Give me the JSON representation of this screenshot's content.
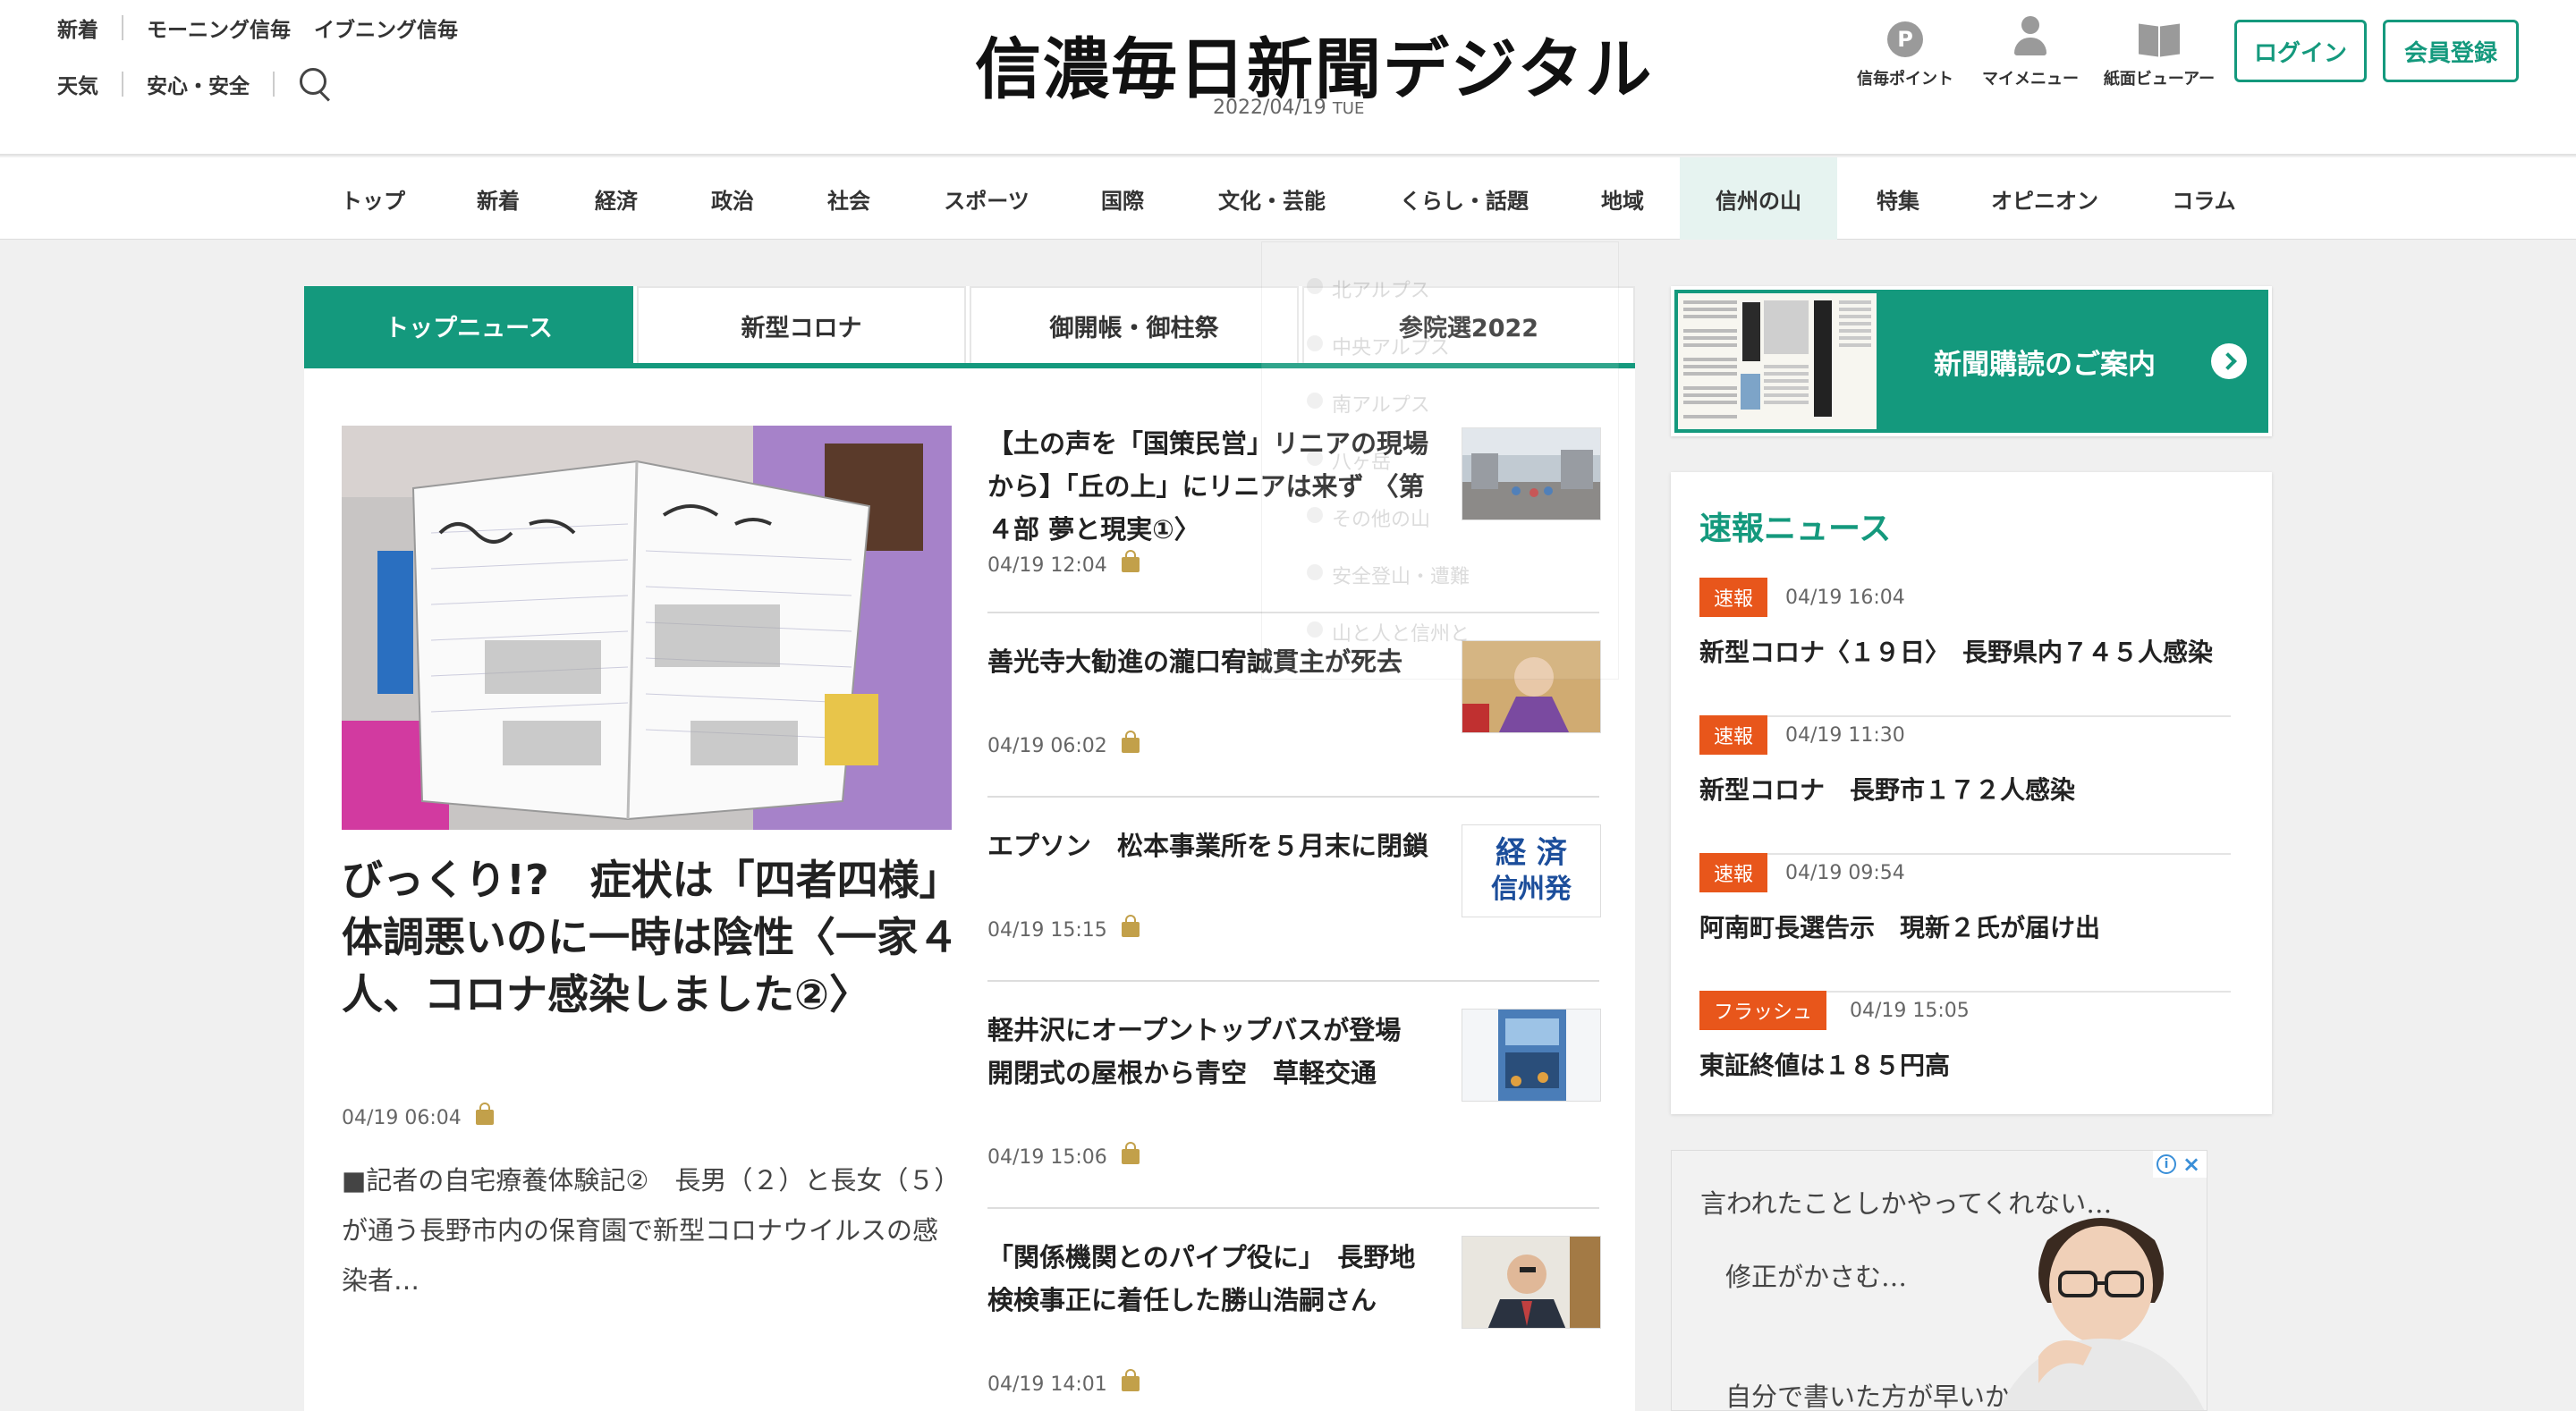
{
  "header": {
    "links_row1": [
      "新着",
      "モーニング信毎",
      "イブニング信毎"
    ],
    "links_row2": [
      "天気",
      "安心・安全"
    ],
    "logo": "信濃毎日新聞デジタル",
    "date": "2022/04/19",
    "weekday": "TUE",
    "icons": [
      {
        "label": "信毎ポイント",
        "icon": "points-icon"
      },
      {
        "label": "マイメニュー",
        "icon": "user-icon"
      },
      {
        "label": "紙面ビューアー",
        "icon": "book-icon"
      }
    ],
    "login_label": "ログイン",
    "register_label": "会員登録",
    "accent": "#14997d"
  },
  "nav": [
    "トップ",
    "新着",
    "経済",
    "政治",
    "社会",
    "スポーツ",
    "国際",
    "文化・芸能",
    "くらし・話題",
    "地域",
    "信州の山",
    "特集",
    "オピニオン",
    "コラム"
  ],
  "dropdown": [
    "北アルプス",
    "中央アルプス",
    "南アルプス",
    "八ヶ岳",
    "その他の山",
    "安全登山・遭難",
    "山と人と信州と"
  ],
  "tabs": [
    "トップニュース",
    "新型コロナ",
    "御開帳・御柱祭",
    "参院選2022"
  ],
  "lead": {
    "title": "びっくり!?　症状は「四者四様」　体調悪いのに一時は陰性〈一家４人、コロナ感染しました②〉",
    "time": "04/19 06:04",
    "body": "■記者の自宅療養体験記②　長男（２）と長女（５）が通う長野市内の保育園で新型コロナウイルスの感染者…"
  },
  "articles": [
    {
      "title": "【土の声を「国策民営」リニアの現場から】「丘の上」にリニアは来ず 〈第４部 夢と現実①〉",
      "time": "04/19 12:04"
    },
    {
      "title": "善光寺大勧進の瀧口宥誠貫主が死去",
      "time": "04/19 06:02"
    },
    {
      "title": "エプソン　松本事業所を５月末に閉鎖",
      "time": "04/19 15:15",
      "thumb_text": [
        "経 済",
        "信州発"
      ]
    },
    {
      "title": "軽井沢にオープントップバスが登場　開閉式の屋根から青空　草軽交通",
      "time": "04/19 15:06"
    },
    {
      "title": "「関係機関とのパイプ役に」　長野地検検事正に着任した勝山浩嗣さん",
      "time": "04/19 14:01"
    }
  ],
  "promo": {
    "label": "新聞購読のご案内"
  },
  "breaking": {
    "title": "速報ニュース",
    "items": [
      {
        "badge": "速報",
        "time": "04/19 16:04",
        "headline": "新型コロナ〈１９日〉　長野県内７４５人感染"
      },
      {
        "badge": "速報",
        "time": "04/19 11:30",
        "headline": "新型コロナ　長野市１７２人感染"
      },
      {
        "badge": "速報",
        "time": "04/19 09:54",
        "headline": "阿南町長選告示　現新２氏が届け出"
      },
      {
        "badge": "フラッシュ",
        "time": "04/19 15:05",
        "headline": "東証終値は１８５円高"
      }
    ]
  },
  "ad": {
    "lines": [
      "言われたことしかやってくれない…",
      "修正がかさむ…",
      "自分で書いた方が早いかも？"
    ]
  }
}
